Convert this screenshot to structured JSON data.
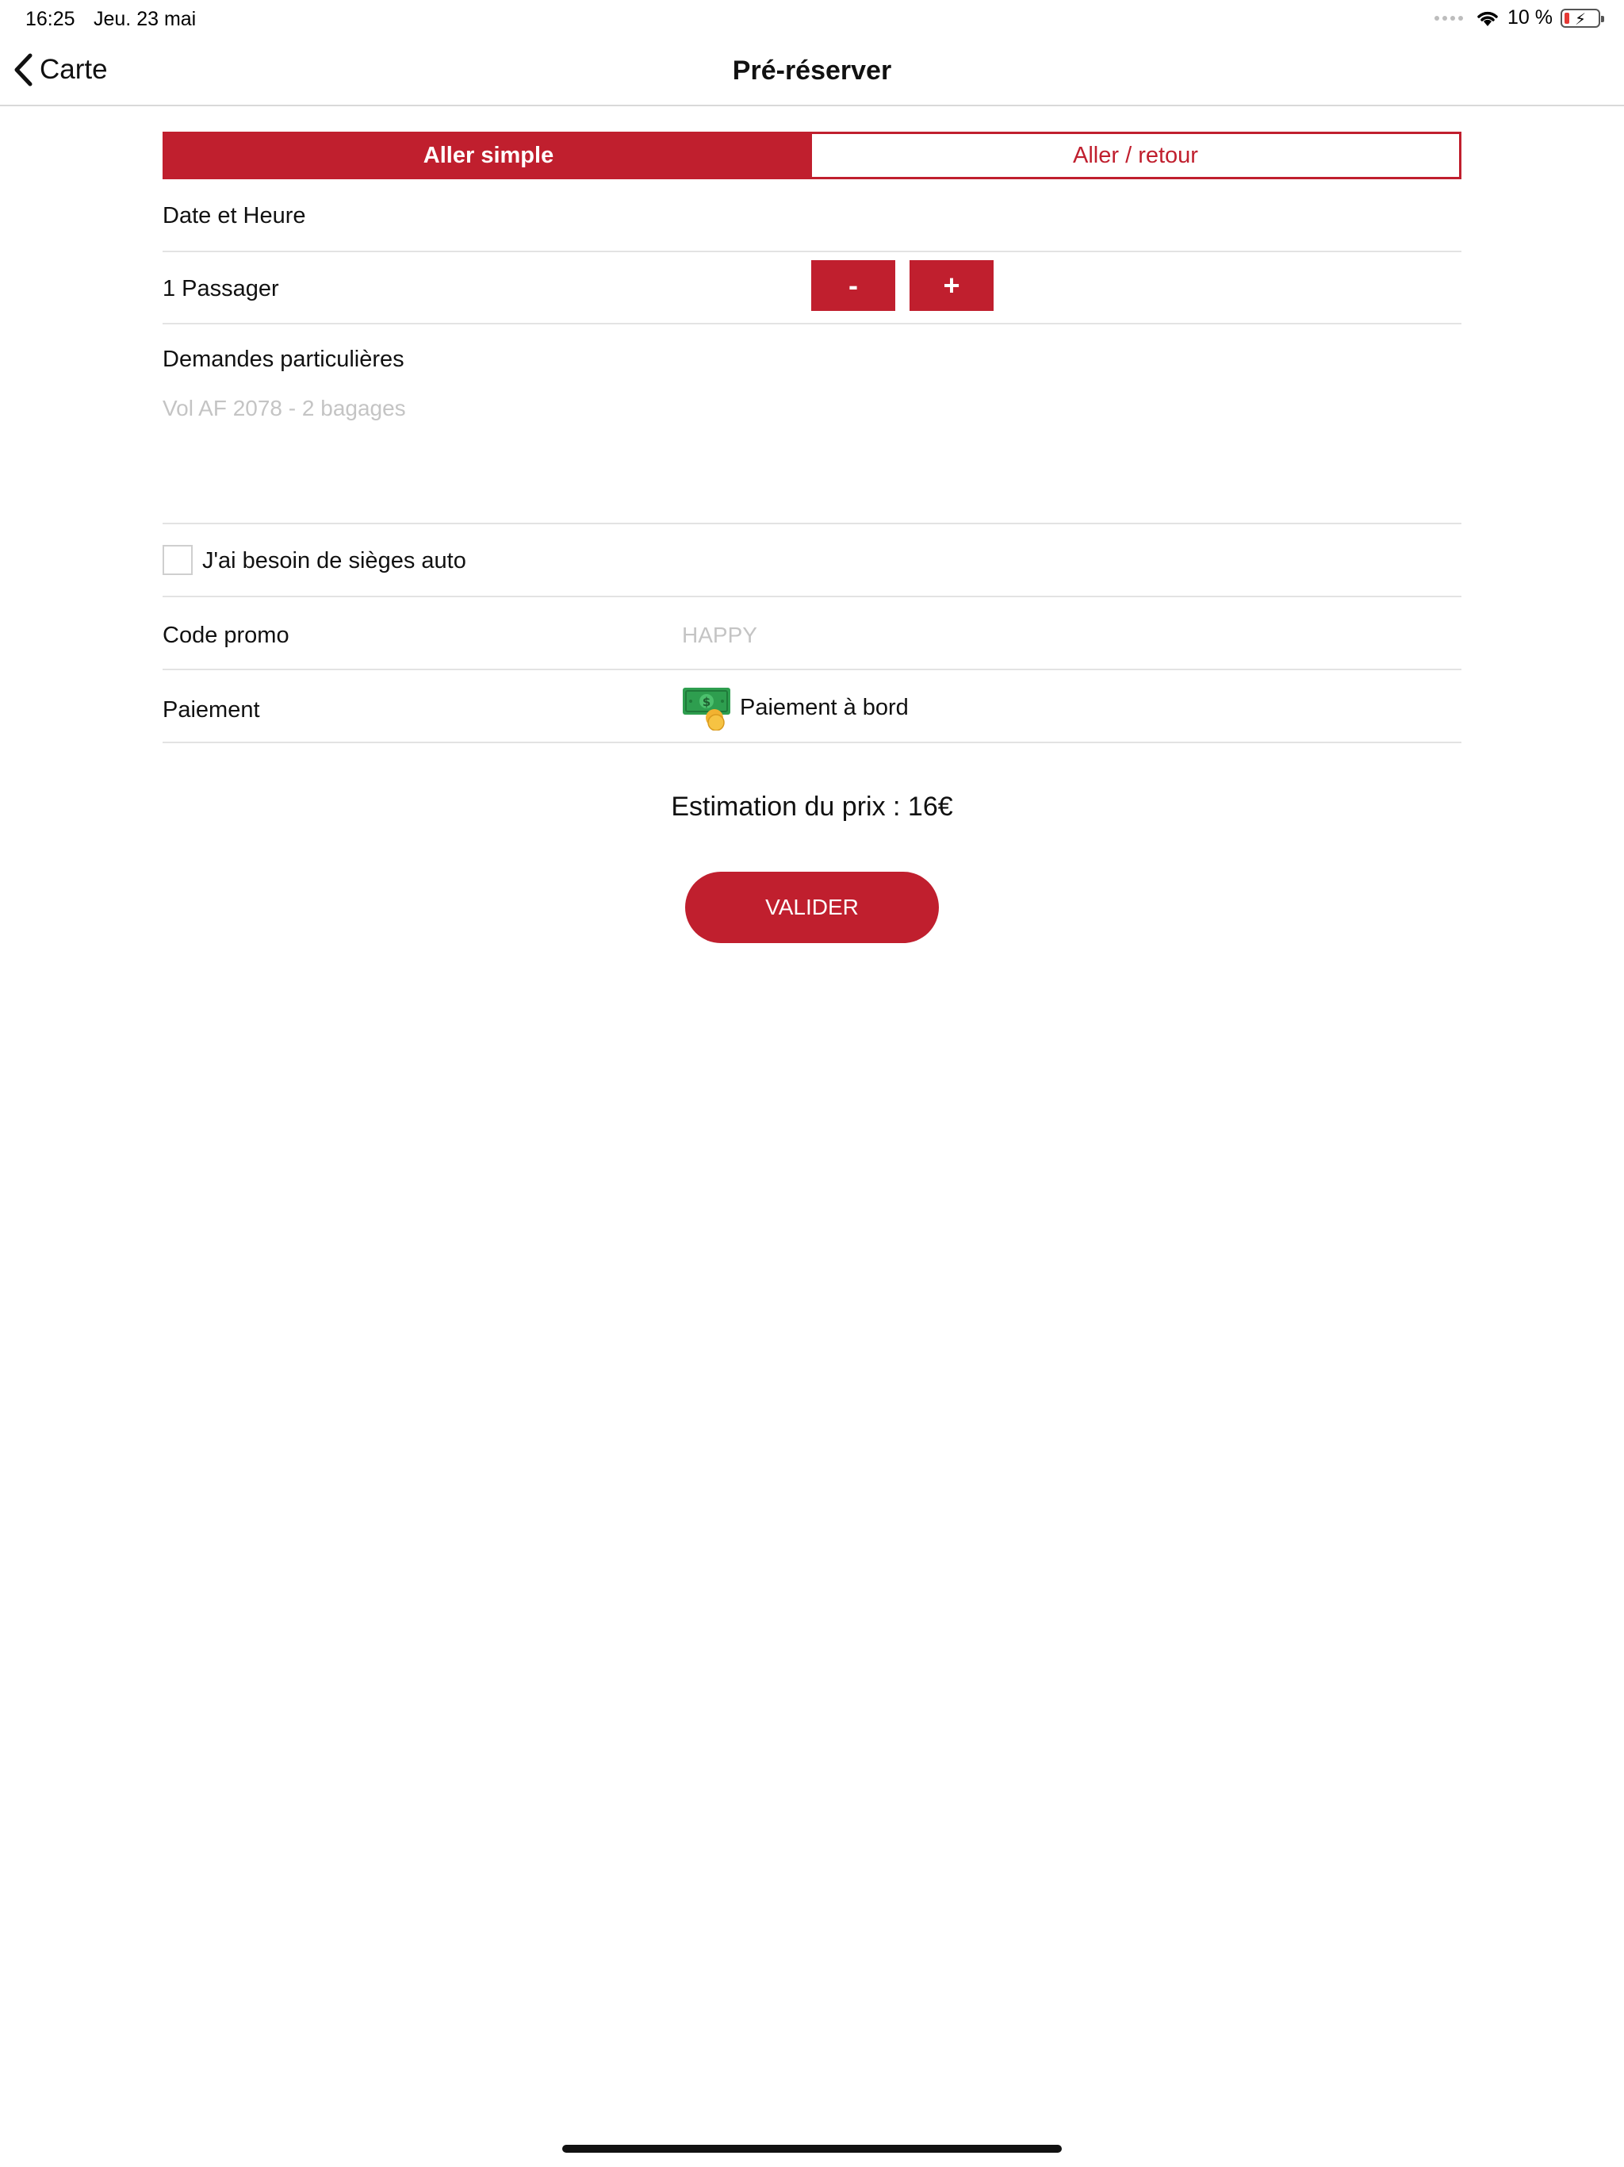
{
  "status_bar": {
    "time": "16:25",
    "date": "Jeu. 23 mai",
    "battery": "10 %"
  },
  "nav": {
    "back_label": "Carte",
    "title": "Pré-réserver"
  },
  "trip_type": {
    "one_way": "Aller simple",
    "round_trip": "Aller / retour"
  },
  "form": {
    "date_label": "Date et Heure",
    "passengers_label": "1 Passager",
    "decrement_label": "-",
    "increment_label": "+",
    "special_requests_label": "Demandes particulières",
    "special_requests_placeholder": "Vol AF 2078 - 2 bagages",
    "child_seat_label": "J'ai besoin de sièges auto",
    "promo_label": "Code promo",
    "promo_placeholder": "HAPPY",
    "payment_label": "Paiement",
    "payment_value": "Paiement à bord"
  },
  "estimate": "Estimation du prix : 16€",
  "submit_label": "VALIDER",
  "colors": {
    "accent": "#c01f2e",
    "divider": "#e3e3e3",
    "placeholder": "#c4c4c4"
  },
  "icons": {
    "back": "chevron-left-icon",
    "wifi": "wifi-icon",
    "battery": "battery-charging-icon",
    "cash": "cash-icon"
  }
}
